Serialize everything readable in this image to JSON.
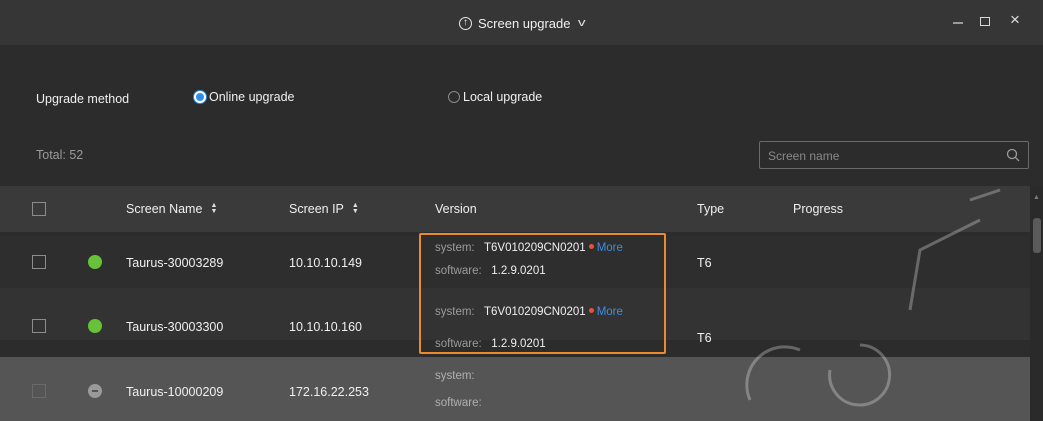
{
  "window": {
    "title": "Screen upgrade"
  },
  "upgrade": {
    "label": "Upgrade method",
    "options": [
      {
        "label": "Online upgrade",
        "selected": true
      },
      {
        "label": "Local upgrade",
        "selected": false
      }
    ]
  },
  "summary": {
    "total": "Total: 52"
  },
  "search": {
    "placeholder": "Screen name"
  },
  "table": {
    "columns": {
      "name": "Screen Name",
      "ip": "Screen IP",
      "version": "Version",
      "type": "Type",
      "progress": "Progress"
    },
    "rows": [
      {
        "status": "online",
        "name": "Taurus-30003289",
        "ip": "10.10.10.149",
        "system_label": "system:",
        "system": "T6V010209CN0201",
        "more": "More",
        "software_label": "software:",
        "software": "1.2.9.0201",
        "type": "T6"
      },
      {
        "status": "online",
        "name": "Taurus-30003300",
        "ip": "10.10.10.160",
        "system_label": "system:",
        "system": "T6V010209CN0201",
        "more": "More",
        "software_label": "software:",
        "software": "1.2.9.0201",
        "type": "T6"
      },
      {
        "status": "offline",
        "name": "Taurus-10000209",
        "ip": "172.16.22.253",
        "system_label": "system:",
        "system": "",
        "software_label": "software:",
        "software": "",
        "type": ""
      }
    ]
  },
  "colors": {
    "accent": "#2f8de4",
    "online": "#67c23a",
    "offline": "#9a9a9a",
    "highlight": "#ee8a2e",
    "update_dot": "#e5533d"
  }
}
